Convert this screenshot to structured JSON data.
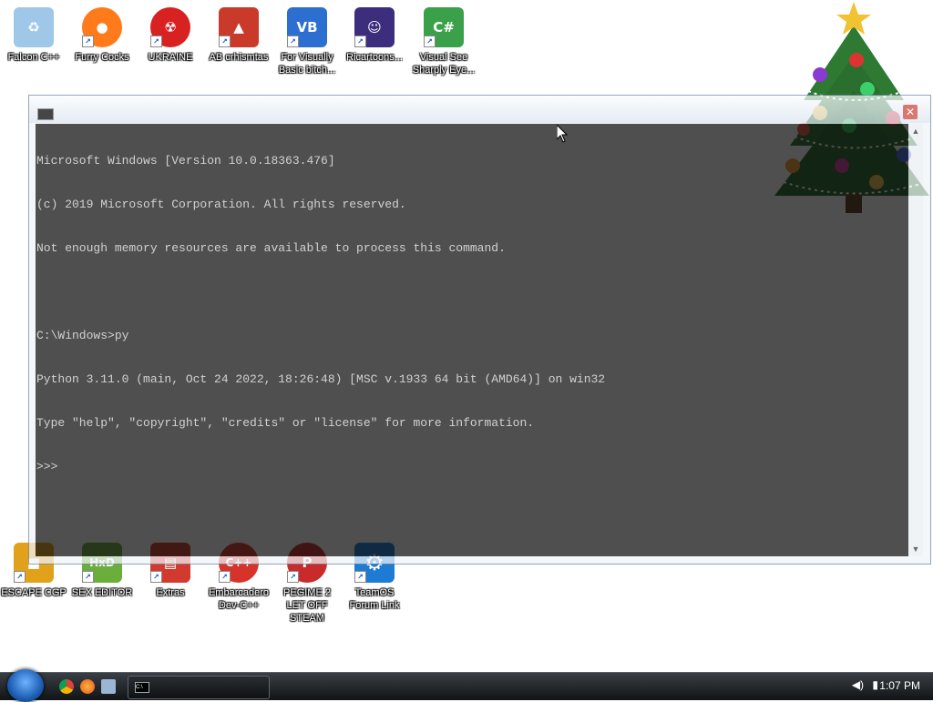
{
  "desktop": {
    "icons": [
      {
        "label": "Falcon C++",
        "color": "#4aa0e0",
        "glyph": "♻"
      },
      {
        "label": "Furry Cocks",
        "color": "#ff7a1a",
        "glyph": "●"
      },
      {
        "label": "UKRAINE",
        "color": "#d82222",
        "glyph": "☢"
      },
      {
        "label": "AB crhismtas",
        "color": "#c93a2a",
        "glyph": "▲"
      },
      {
        "label": "For Visually Basic bitch...",
        "color": "#2d6fd1",
        "glyph": "VB"
      },
      {
        "label": "Ricartoons...",
        "color": "#3c2e7c",
        "glyph": "☺"
      },
      {
        "label": "Visual See Sharply Eye...",
        "color": "#3aa049",
        "glyph": "C#"
      },
      {
        "label": "ESCAPE CGP",
        "color": "#e2a11a",
        "glyph": "■"
      },
      {
        "label": "SEX EDITOR",
        "color": "#6cae3c",
        "glyph": "HxD"
      },
      {
        "label": "Extras",
        "color": "#d23a2f",
        "glyph": "▤"
      },
      {
        "label": "Embarcadero Dev-C++",
        "color": "#d6332a",
        "glyph": "C++"
      },
      {
        "label": "PEGIME 2 LET OFF STEAM",
        "color": "#c92a2a",
        "glyph": "P"
      },
      {
        "label": "TeamOS Forum Link",
        "color": "#1e7bd4",
        "glyph": "⚙"
      }
    ]
  },
  "console": {
    "title": "",
    "close_label": "✕",
    "lines": [
      "Microsoft Windows [Version 10.0.18363.476]",
      "(c) 2019 Microsoft Corporation. All rights reserved.",
      "Not enough memory resources are available to process this command.",
      "",
      "C:\\Windows>py",
      "Python 3.11.0 (main, Oct 24 2022, 18:26:48) [MSC v.1933 64 bit (AMD64)] on win32",
      "Type \"help\", \"copyright\", \"credits\" or \"license\" for more information.",
      ">>> "
    ]
  },
  "taskbar": {
    "clock": "1:07 PM",
    "task_button_icon": "C:\\"
  }
}
